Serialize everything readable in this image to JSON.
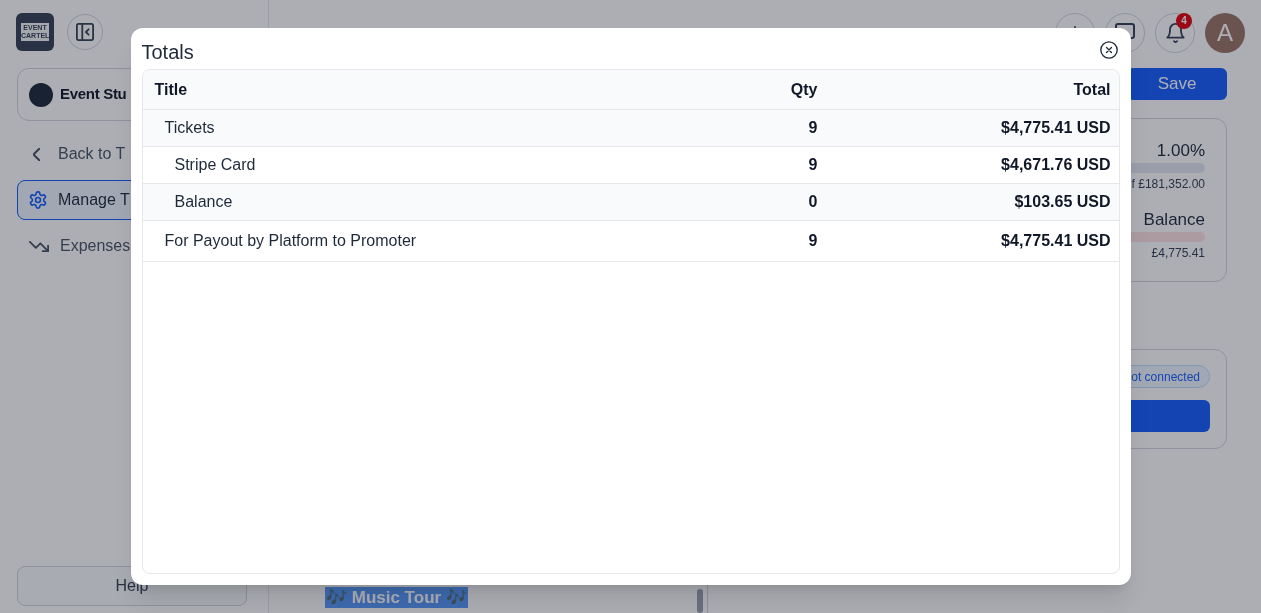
{
  "sidebar": {
    "logo_text": "EVENT CARTEL",
    "event_name": "Event Stu",
    "back_link": "Back to T",
    "nav": [
      {
        "label": "Manage T",
        "selected": true
      },
      {
        "label": "Expenses",
        "selected": false
      }
    ],
    "help": "Help"
  },
  "header": {
    "notification_count": "4",
    "avatar_initial": "A"
  },
  "main": {
    "title": {
      "text": "🎶 Music Tour 🎶",
      "highlighted": true
    }
  },
  "side_panel": {
    "save": "Save",
    "summary": {
      "percent": "1.00%",
      "goal": "f £181,352.00",
      "balance_label": "Balance",
      "balance_amount": "£4,775.41"
    },
    "connection": {
      "status": "ot connected"
    }
  },
  "modal": {
    "title": "Totals",
    "columns": [
      "Title",
      "Qty",
      "Total"
    ],
    "rows": [
      {
        "title": "Tickets",
        "qty": "9",
        "total": "$4,775.41 USD",
        "children": [
          {
            "title": "Stripe Card",
            "qty": "9",
            "total": "$4,671.76 USD"
          },
          {
            "title": "Balance",
            "qty": "0",
            "total": "$103.65 USD"
          }
        ]
      },
      {
        "title": "For Payout by Platform to Promoter",
        "qty": "9",
        "total": "$4,775.41 USD"
      }
    ]
  }
}
